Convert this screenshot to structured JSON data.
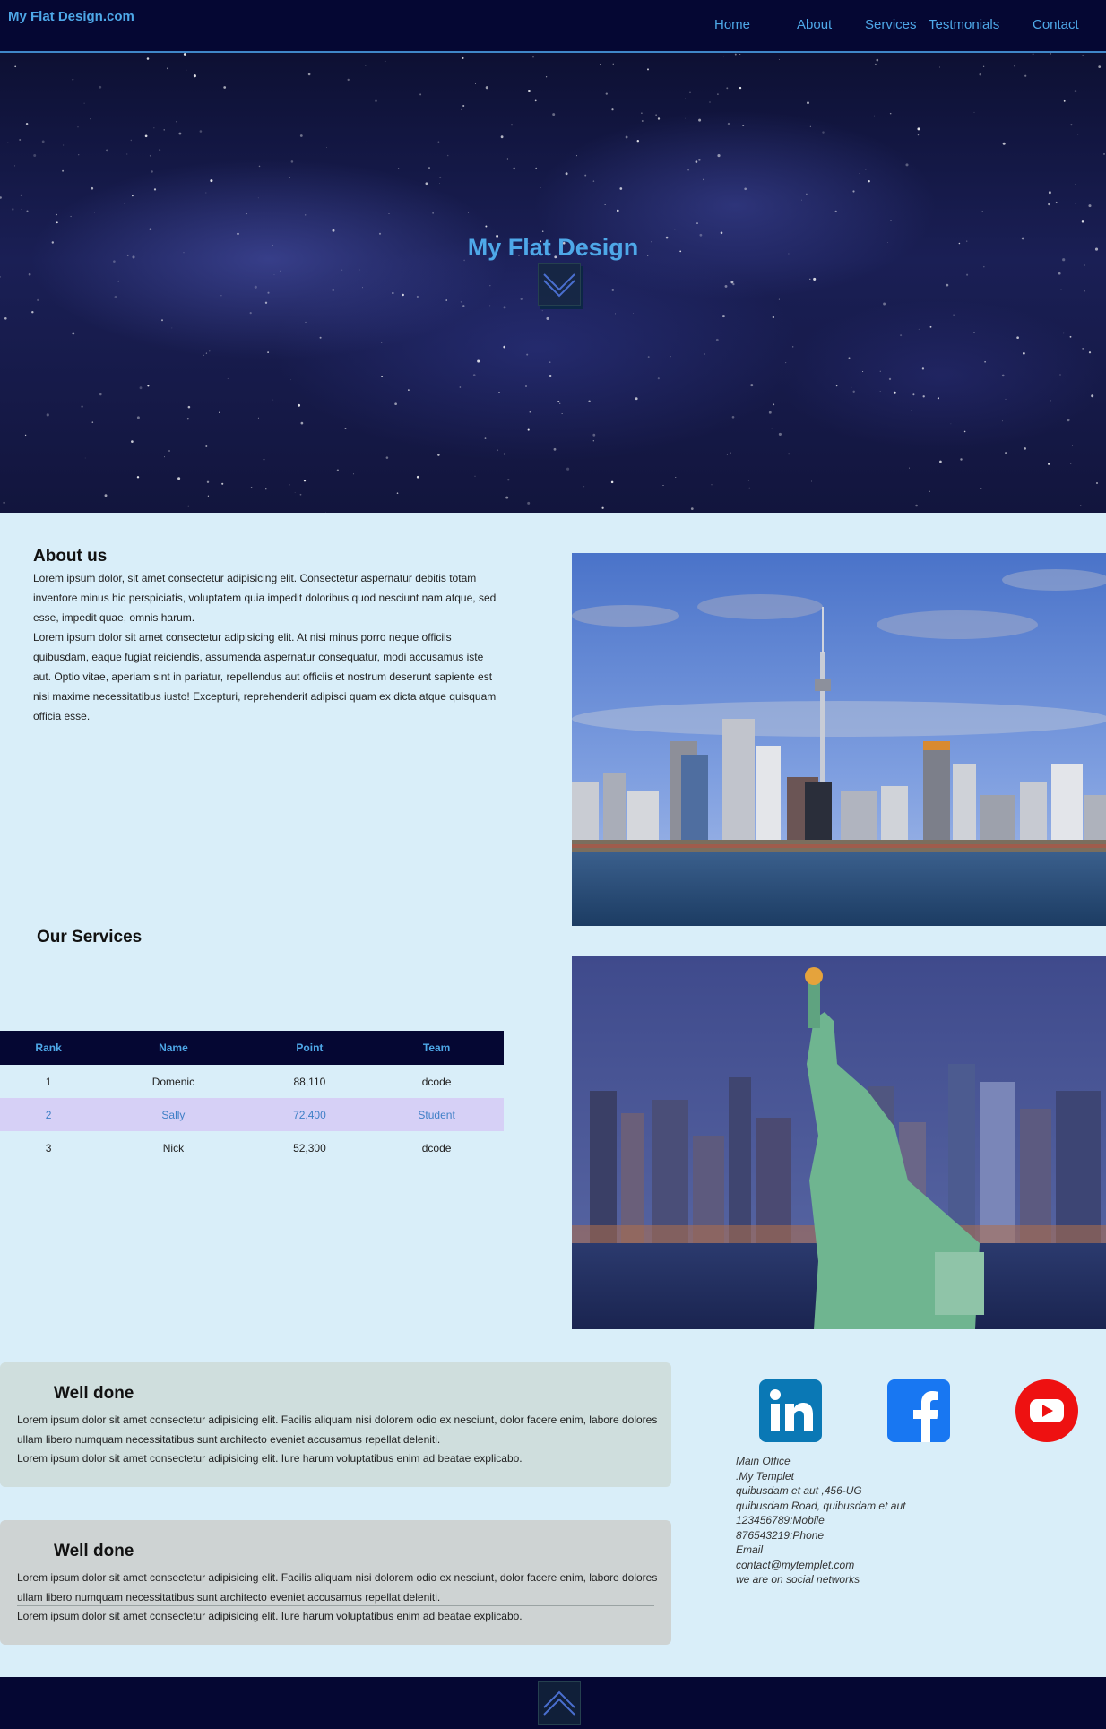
{
  "nav": {
    "brand": "My Flat Design.com",
    "links": [
      {
        "label": "Home"
      },
      {
        "label": "About"
      },
      {
        "label": "Services"
      },
      {
        "label": "Testmonials"
      },
      {
        "label": "Contact"
      }
    ]
  },
  "hero": {
    "title": "My Flat Design",
    "scroll_icon": "chevron-down-icon"
  },
  "about": {
    "title": "About us",
    "paragraphs": [
      "Lorem ipsum dolor, sit amet consectetur adipisicing elit. Consectetur aspernatur debitis totam inventore minus hic perspiciatis, voluptatem quia impedit doloribus quod nesciunt nam atque, sed esse, impedit quae, omnis harum.",
      "Lorem ipsum dolor sit amet consectetur adipisicing elit. At nisi minus porro neque officiis quibusdam, eaque fugiat reiciendis, assumenda aspernatur consequatur, modi accusamus iste aut. Optio vitae, aperiam sint in pariatur, repellendus aut officiis et nostrum deserunt sapiente est nisi maxime necessitatibus iusto! Excepturi, reprehenderit adipisci quam ex dicta atque quisquam officia esse."
    ],
    "image": "city-skyline-photo"
  },
  "services": {
    "title": "Our Services",
    "image": "statue-of-liberty-photo",
    "table": {
      "headers": [
        "Rank",
        "Name",
        "Point",
        "Team"
      ],
      "rows": [
        [
          "1",
          "Domenic",
          "88,110",
          "dcode"
        ],
        [
          "2",
          "Sally",
          "72,400",
          "Student"
        ],
        [
          "3",
          "Nick",
          "52,300",
          "dcode"
        ]
      ]
    }
  },
  "testimonials": [
    {
      "title": "Well done",
      "text": "Lorem ipsum dolor sit amet consectetur adipisicing elit. Facilis aliquam nisi dolorem odio ex nesciunt, dolor facere enim, labore dolores ullam libero numquam necessitatibus sunt architecto eveniet accusamus repellat deleniti.",
      "footer": "Lorem ipsum dolor sit amet consectetur adipisicing elit. Iure harum voluptatibus enim ad beatae explicabo.",
      "bg": "#cfdedd"
    },
    {
      "title": "Well done",
      "text": "Lorem ipsum dolor sit amet consectetur adipisicing elit. Facilis aliquam nisi dolorem odio ex nesciunt, dolor facere enim, labore dolores ullam libero numquam necessitatibus sunt architecto eveniet accusamus repellat deleniti.",
      "footer": "Lorem ipsum dolor sit amet consectetur adipisicing elit. Iure harum voluptatibus enim ad beatae explicabo.",
      "bg": "#ced3d3"
    }
  ],
  "social": [
    {
      "name": "linkedin-icon",
      "color": "#0a78b5"
    },
    {
      "name": "facebook-icon",
      "color": "#1877f2"
    },
    {
      "name": "youtube-icon",
      "color": "#ee1111"
    }
  ],
  "contact": {
    "lines": [
      "Main Office",
      ".My Templet",
      "quibusdam et aut ,456-UG",
      "quibusdam Road, quibusdam et aut",
      "123456789:Mobile",
      "876543219:Phone",
      "Email",
      "contact@mytemplet.com",
      "we are on social networks"
    ]
  },
  "footer": {
    "scroll_icon": "chevron-up-icon"
  },
  "colors": {
    "navy": "#050733",
    "accent": "#4ea8e8",
    "page_bg": "#d9eef9",
    "highlight_row": "#d6d0f6"
  }
}
